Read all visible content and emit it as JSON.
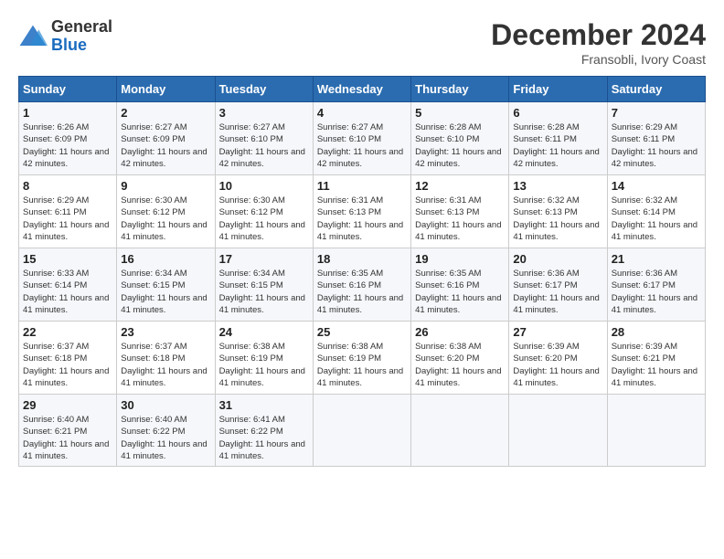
{
  "header": {
    "logo": {
      "line1": "General",
      "line2": "Blue"
    },
    "title": "December 2024",
    "location": "Fransobli, Ivory Coast"
  },
  "weekdays": [
    "Sunday",
    "Monday",
    "Tuesday",
    "Wednesday",
    "Thursday",
    "Friday",
    "Saturday"
  ],
  "weeks": [
    [
      {
        "day": 1,
        "sunrise": "6:26 AM",
        "sunset": "6:09 PM",
        "daylight": "11 hours and 42 minutes."
      },
      {
        "day": 2,
        "sunrise": "6:27 AM",
        "sunset": "6:09 PM",
        "daylight": "11 hours and 42 minutes."
      },
      {
        "day": 3,
        "sunrise": "6:27 AM",
        "sunset": "6:10 PM",
        "daylight": "11 hours and 42 minutes."
      },
      {
        "day": 4,
        "sunrise": "6:27 AM",
        "sunset": "6:10 PM",
        "daylight": "11 hours and 42 minutes."
      },
      {
        "day": 5,
        "sunrise": "6:28 AM",
        "sunset": "6:10 PM",
        "daylight": "11 hours and 42 minutes."
      },
      {
        "day": 6,
        "sunrise": "6:28 AM",
        "sunset": "6:11 PM",
        "daylight": "11 hours and 42 minutes."
      },
      {
        "day": 7,
        "sunrise": "6:29 AM",
        "sunset": "6:11 PM",
        "daylight": "11 hours and 42 minutes."
      }
    ],
    [
      {
        "day": 8,
        "sunrise": "6:29 AM",
        "sunset": "6:11 PM",
        "daylight": "11 hours and 41 minutes."
      },
      {
        "day": 9,
        "sunrise": "6:30 AM",
        "sunset": "6:12 PM",
        "daylight": "11 hours and 41 minutes."
      },
      {
        "day": 10,
        "sunrise": "6:30 AM",
        "sunset": "6:12 PM",
        "daylight": "11 hours and 41 minutes."
      },
      {
        "day": 11,
        "sunrise": "6:31 AM",
        "sunset": "6:13 PM",
        "daylight": "11 hours and 41 minutes."
      },
      {
        "day": 12,
        "sunrise": "6:31 AM",
        "sunset": "6:13 PM",
        "daylight": "11 hours and 41 minutes."
      },
      {
        "day": 13,
        "sunrise": "6:32 AM",
        "sunset": "6:13 PM",
        "daylight": "11 hours and 41 minutes."
      },
      {
        "day": 14,
        "sunrise": "6:32 AM",
        "sunset": "6:14 PM",
        "daylight": "11 hours and 41 minutes."
      }
    ],
    [
      {
        "day": 15,
        "sunrise": "6:33 AM",
        "sunset": "6:14 PM",
        "daylight": "11 hours and 41 minutes."
      },
      {
        "day": 16,
        "sunrise": "6:34 AM",
        "sunset": "6:15 PM",
        "daylight": "11 hours and 41 minutes."
      },
      {
        "day": 17,
        "sunrise": "6:34 AM",
        "sunset": "6:15 PM",
        "daylight": "11 hours and 41 minutes."
      },
      {
        "day": 18,
        "sunrise": "6:35 AM",
        "sunset": "6:16 PM",
        "daylight": "11 hours and 41 minutes."
      },
      {
        "day": 19,
        "sunrise": "6:35 AM",
        "sunset": "6:16 PM",
        "daylight": "11 hours and 41 minutes."
      },
      {
        "day": 20,
        "sunrise": "6:36 AM",
        "sunset": "6:17 PM",
        "daylight": "11 hours and 41 minutes."
      },
      {
        "day": 21,
        "sunrise": "6:36 AM",
        "sunset": "6:17 PM",
        "daylight": "11 hours and 41 minutes."
      }
    ],
    [
      {
        "day": 22,
        "sunrise": "6:37 AM",
        "sunset": "6:18 PM",
        "daylight": "11 hours and 41 minutes."
      },
      {
        "day": 23,
        "sunrise": "6:37 AM",
        "sunset": "6:18 PM",
        "daylight": "11 hours and 41 minutes."
      },
      {
        "day": 24,
        "sunrise": "6:38 AM",
        "sunset": "6:19 PM",
        "daylight": "11 hours and 41 minutes."
      },
      {
        "day": 25,
        "sunrise": "6:38 AM",
        "sunset": "6:19 PM",
        "daylight": "11 hours and 41 minutes."
      },
      {
        "day": 26,
        "sunrise": "6:38 AM",
        "sunset": "6:20 PM",
        "daylight": "11 hours and 41 minutes."
      },
      {
        "day": 27,
        "sunrise": "6:39 AM",
        "sunset": "6:20 PM",
        "daylight": "11 hours and 41 minutes."
      },
      {
        "day": 28,
        "sunrise": "6:39 AM",
        "sunset": "6:21 PM",
        "daylight": "11 hours and 41 minutes."
      }
    ],
    [
      {
        "day": 29,
        "sunrise": "6:40 AM",
        "sunset": "6:21 PM",
        "daylight": "11 hours and 41 minutes."
      },
      {
        "day": 30,
        "sunrise": "6:40 AM",
        "sunset": "6:22 PM",
        "daylight": "11 hours and 41 minutes."
      },
      {
        "day": 31,
        "sunrise": "6:41 AM",
        "sunset": "6:22 PM",
        "daylight": "11 hours and 41 minutes."
      },
      null,
      null,
      null,
      null
    ]
  ]
}
